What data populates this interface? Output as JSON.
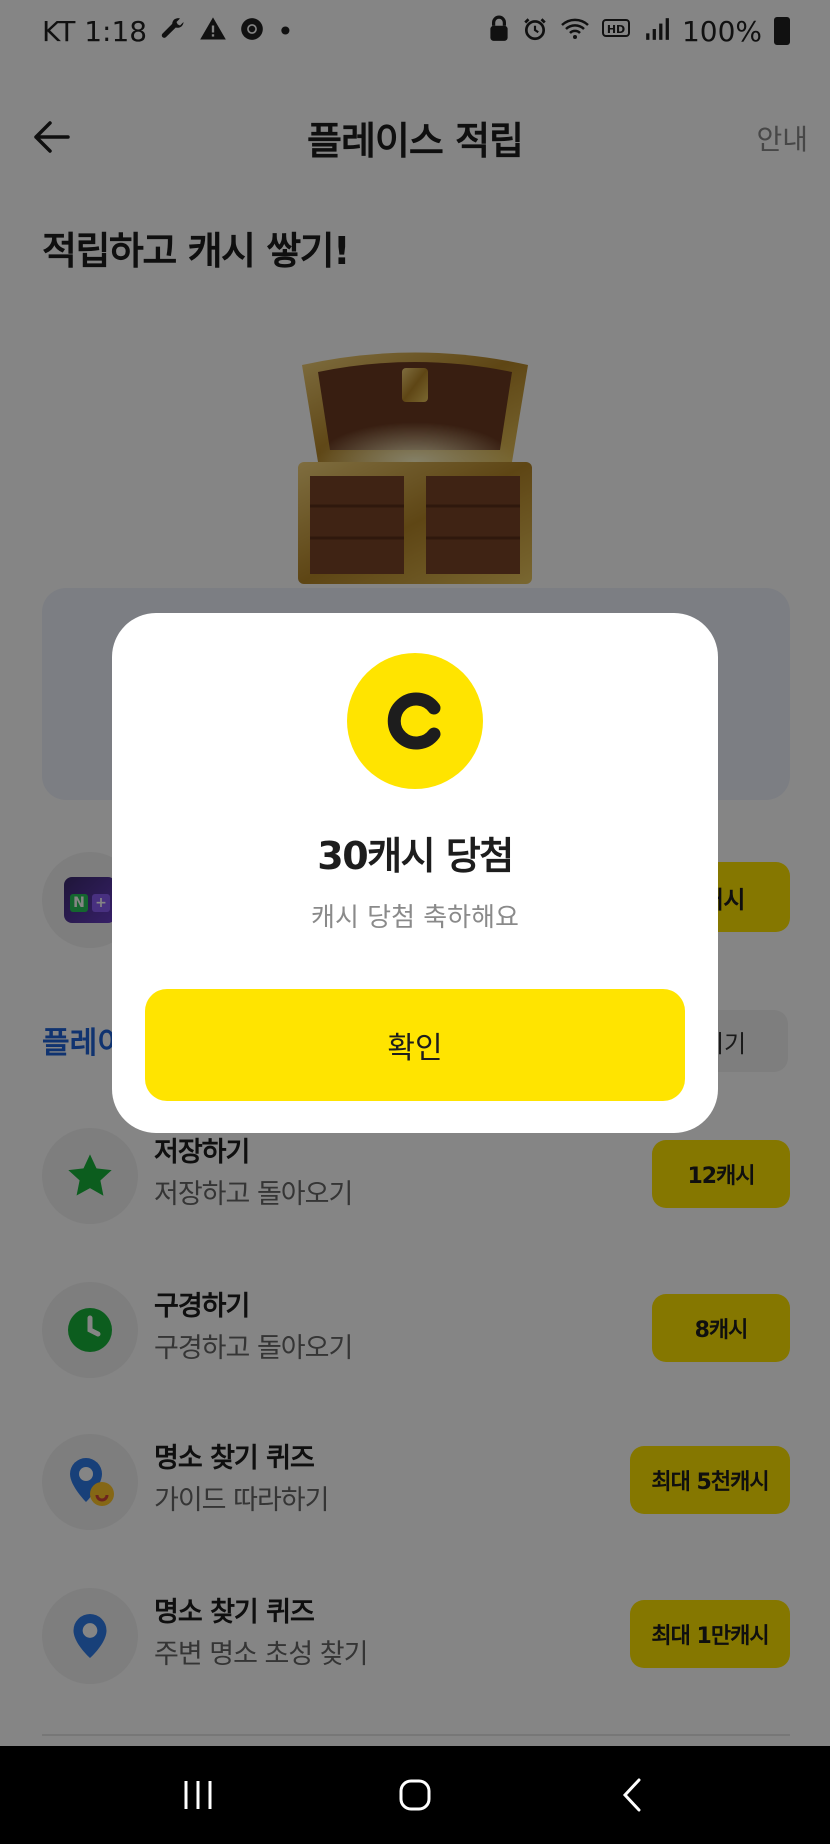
{
  "status_bar": {
    "carrier_time": "KT 1:18",
    "dot": "•",
    "battery": "100%",
    "left_icons": [
      "wrench-icon",
      "warning-icon",
      "chrome-icon"
    ],
    "right_icons": [
      "lock-icon",
      "alarm-icon",
      "wifi-icon",
      "hd-icon",
      "signal-icon",
      "battery-icon"
    ]
  },
  "header": {
    "title": "플레이스 적립",
    "guide_label": "안내"
  },
  "hero": {
    "title": "적립하고 캐시 쌓기!"
  },
  "np_row": {
    "reward_label": "0캐시"
  },
  "section": {
    "title": "플레이",
    "share_label": "올리기"
  },
  "missions": [
    {
      "title": "저장하기",
      "subtitle": "저장하고 돌아오기",
      "reward": "12캐시",
      "icon": "star-icon"
    },
    {
      "title": "구경하기",
      "subtitle": "구경하고 돌아오기",
      "reward": "8캐시",
      "icon": "clock-icon"
    },
    {
      "title": "명소 찾기 퀴즈",
      "subtitle": "가이드 따라하기",
      "reward": "최대 5천캐시",
      "icon": "map-pin-smile-icon"
    },
    {
      "title": "명소 찾기 퀴즈",
      "subtitle": "주변 명소 초성 찾기",
      "reward": "최대 1만캐시",
      "icon": "map-pin-icon"
    }
  ],
  "modal": {
    "badge_letter": "C",
    "title": "30캐시 당첨",
    "subtitle": "캐시 당첨 축하해요",
    "confirm_label": "확인"
  },
  "colors": {
    "accent_yellow": "#ffe400",
    "section_blue": "#1f63d6",
    "overlay": "rgba(0,0,0,0.48)"
  }
}
